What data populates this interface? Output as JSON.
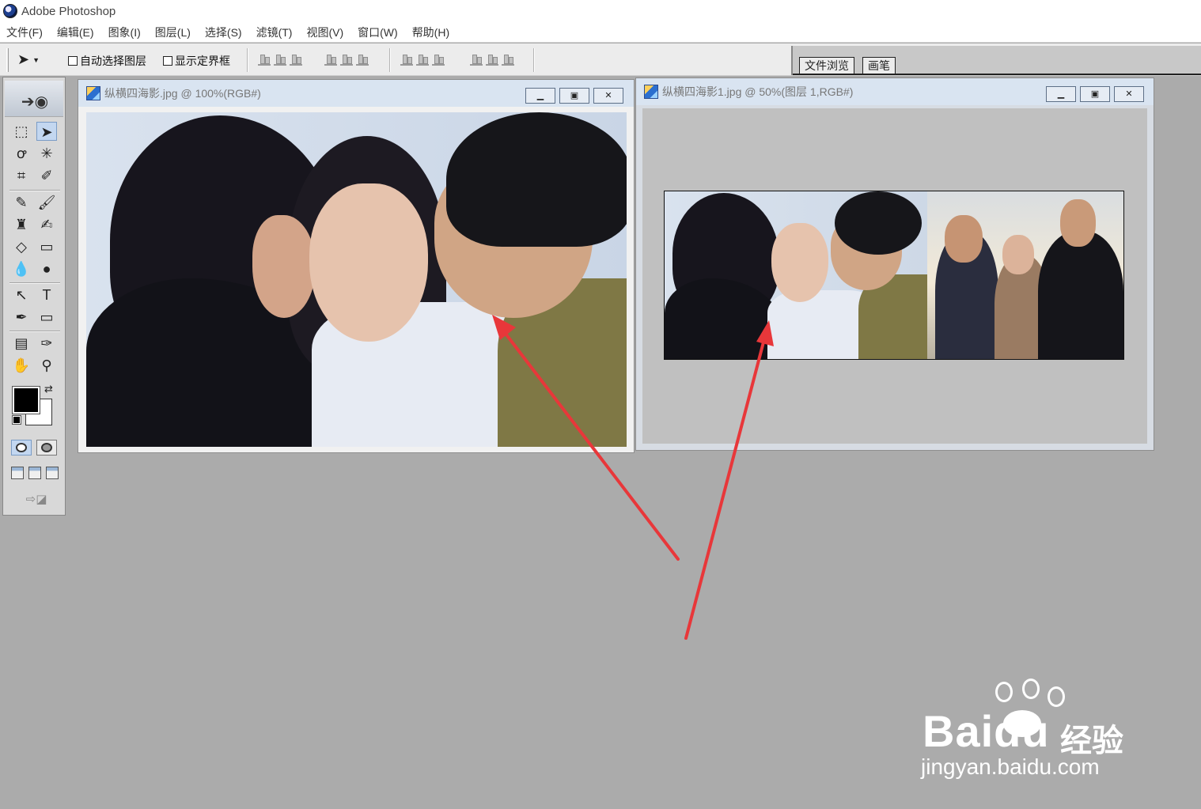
{
  "app": {
    "title": "Adobe Photoshop"
  },
  "menubar": {
    "items": [
      "文件(F)",
      "编辑(E)",
      "图象(I)",
      "图层(L)",
      "选择(S)",
      "滤镜(T)",
      "视图(V)",
      "窗口(W)",
      "帮助(H)"
    ]
  },
  "options_bar": {
    "auto_select_layer": {
      "label": "自动选择图层",
      "checked": false
    },
    "show_bounding_box": {
      "label": "显示定界框",
      "checked": false
    }
  },
  "palette_well": {
    "tabs": [
      "文件浏览",
      "画笔"
    ]
  },
  "toolbox": {
    "active_tool": "move-tool",
    "foreground_color": "#000000",
    "background_color": "#ffffff"
  },
  "documents": [
    {
      "title": "纵横四海影.jpg @ 100%(RGB#)"
    },
    {
      "title": "纵横四海影1.jpg @ 50%(图层 1,RGB#)"
    }
  ],
  "annotation": {
    "arrow_color": "#e8373a"
  },
  "watermark": {
    "brand": "Baidu",
    "cn": "经验",
    "url": "jingyan.baidu.com"
  }
}
